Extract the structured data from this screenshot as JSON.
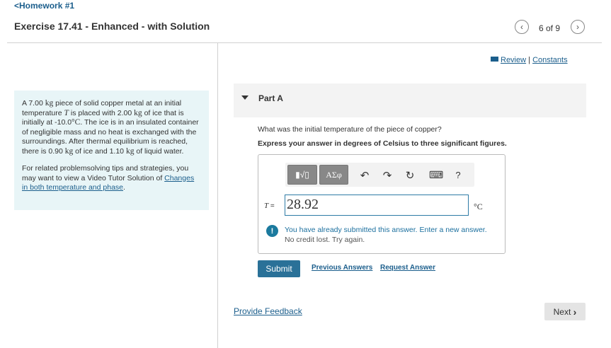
{
  "header": {
    "back_link": "Homework #1",
    "title": "Exercise 17.41 - Enhanced - with Solution",
    "pager": "6 of 9",
    "prev_icon": "chevron-left-icon",
    "next_icon": "chevron-right-icon"
  },
  "problem": {
    "p1_a": "A 7.00 ",
    "p1_kg1": "kg",
    "p1_b": " piece of solid copper metal at an initial temperature ",
    "p1_T": "T",
    "p1_c": " is placed with 2.00 ",
    "p1_kg2": "kg",
    "p1_d": " of ice that is initially at -10.0",
    "p1_degC": "°C",
    "p1_e": ". The ice is in an insulated container of negligible mass and no heat is exchanged with the surroundings. After thermal equilibrium is reached, there is 0.90 ",
    "p1_kg3": "kg",
    "p1_f": " of ice and 1.10 ",
    "p1_kg4": "kg",
    "p1_g": " of liquid water.",
    "p2_text": "For related problemsolving tips and strategies, you may want to view a Video Tutor Solution of ",
    "p2_link": "Changes in both temperature and phase",
    "p2_end": "."
  },
  "links": {
    "review": "Review",
    "separator": "|",
    "constants": "Constants"
  },
  "part": {
    "label": "Part A",
    "question": "What was the initial temperature of the piece of copper?",
    "instruction": "Express your answer in degrees of Celsius to three significant figures."
  },
  "toolbar": {
    "templates_label": "▮√▯",
    "symbols_label": "ΑΣφ",
    "undo_icon": "↶",
    "redo_icon": "↷",
    "reset_icon": "↻",
    "keyboard_icon": "⌨",
    "help_label": "?"
  },
  "answer": {
    "var_label": "T",
    "equals": " =",
    "value": "28.92",
    "unit": "°C"
  },
  "alert": {
    "icon": "!",
    "message": "You have already submitted this answer. Enter a new answer.",
    "sub": "No credit lost. Try again."
  },
  "actions": {
    "submit": "Submit",
    "previous_answers": "Previous Answers",
    "request_answer": "Request Answer",
    "feedback": "Provide Feedback",
    "next": "Next",
    "next_icon": "›"
  }
}
